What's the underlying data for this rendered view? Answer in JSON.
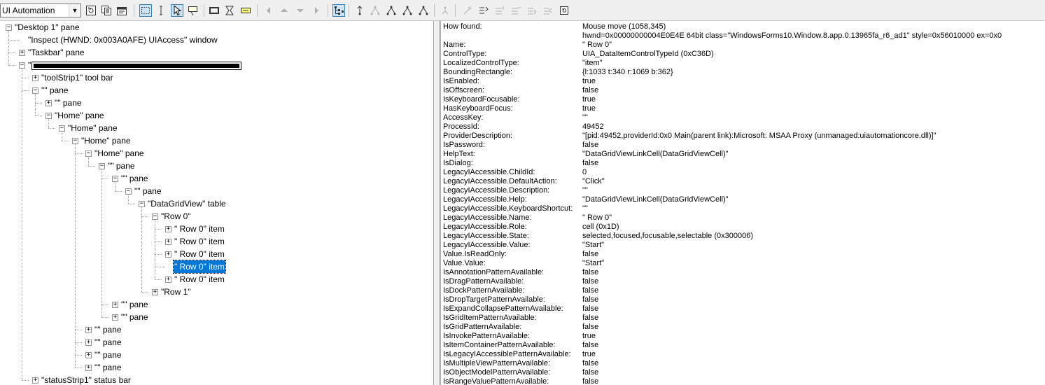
{
  "toolbar": {
    "mode_value": "UI Automation",
    "buttons": [
      "refresh-icon",
      "copy-icon",
      "options-icon",
      "watch-focus-icon",
      "watch-caret-icon",
      "watch-cursor-icon",
      "show-tooltip-icon",
      "highlight-rectangle-icon",
      "show-hidden-icon",
      "show-caret-rect-icon",
      "navigate-back-icon",
      "navigate-parent-icon",
      "navigate-first-child-icon",
      "navigate-next-icon",
      "show-tree-icon",
      "navigate-up-icon",
      "navigate-prev-sibling-icon",
      "navigate-first-icon",
      "navigate-last-icon",
      "navigate-next-sibling-icon",
      "action-icon",
      "default-action-icon",
      "select-icon",
      "add-selection-icon",
      "remove-selection-icon",
      "take-focus-icon",
      "refresh-element-icon"
    ]
  },
  "tree": [
    {
      "label": "\"Desktop 1\" pane",
      "toggle": "-"
    },
    {
      "label": "\"Inspect  (HWND: 0x003A0AFE) UIAccess\" window",
      "toggle": ""
    },
    {
      "label": "\"Taskbar\" pane",
      "toggle": "+"
    },
    {
      "label": "\"",
      "toggle": "-",
      "redacted": true
    },
    {
      "label": "\"toolStrip1\" tool bar",
      "toggle": "+"
    },
    {
      "label": "\"\" pane",
      "toggle": "-"
    },
    {
      "label": "\"\" pane",
      "toggle": "+"
    },
    {
      "label": "\"Home\" pane",
      "toggle": "-"
    },
    {
      "label": "\"Home\" pane",
      "toggle": "-"
    },
    {
      "label": "\"Home\" pane",
      "toggle": "-"
    },
    {
      "label": "\"Home\" pane",
      "toggle": "-"
    },
    {
      "label": "\"\" pane",
      "toggle": "-"
    },
    {
      "label": "\"\" pane",
      "toggle": "-"
    },
    {
      "label": "\"\" pane",
      "toggle": "-"
    },
    {
      "label": "\"DataGridView\" table",
      "toggle": "-"
    },
    {
      "label": "\"Row 0\"",
      "toggle": "-"
    },
    {
      "label": "\" Row 0\" item",
      "toggle": "+"
    },
    {
      "label": "\" Row 0\" item",
      "toggle": "+"
    },
    {
      "label": "\" Row 0\" item",
      "toggle": "+"
    },
    {
      "label": "\" Row 0\" item",
      "toggle": "",
      "selected": true
    },
    {
      "label": "\" Row 0\" item",
      "toggle": "+"
    },
    {
      "label": "\"Row 1\"",
      "toggle": "+"
    },
    {
      "label": "\"\" pane",
      "toggle": "+"
    },
    {
      "label": "\"\" pane",
      "toggle": "+"
    },
    {
      "label": "\"\" pane",
      "toggle": "+"
    },
    {
      "label": "\"\" pane",
      "toggle": "+"
    },
    {
      "label": "\"\" pane",
      "toggle": "+"
    },
    {
      "label": "\"\" pane",
      "toggle": "+"
    },
    {
      "label": "\"statusStrip1\" status bar",
      "toggle": "+"
    }
  ],
  "properties": [
    {
      "key": "How found:",
      "value": "Mouse move (1058,345)"
    },
    {
      "key": "",
      "value": "hwnd=0x00000000004E0E4E 64bit class=\"WindowsForms10.Window.8.app.0.13965fa_r6_ad1\" style=0x56010000 ex=0x0"
    },
    {
      "key": "Name:",
      "value": "\" Row 0\""
    },
    {
      "key": "ControlType:",
      "value": "UIA_DataItemControlTypeId (0xC36D)"
    },
    {
      "key": "LocalizedControlType:",
      "value": "\"item\""
    },
    {
      "key": "BoundingRectangle:",
      "value": "{l:1033 t:340 r:1069 b:362}"
    },
    {
      "key": "IsEnabled:",
      "value": "true"
    },
    {
      "key": "IsOffscreen:",
      "value": "false"
    },
    {
      "key": "IsKeyboardFocusable:",
      "value": "true"
    },
    {
      "key": "HasKeyboardFocus:",
      "value": "true"
    },
    {
      "key": "AccessKey:",
      "value": "\"\""
    },
    {
      "key": "ProcessId:",
      "value": "49452"
    },
    {
      "key": "ProviderDescription:",
      "value": "\"[pid:49452,providerId:0x0 Main(parent link):Microsoft: MSAA Proxy (unmanaged:uiautomationcore.dll)]\""
    },
    {
      "key": "IsPassword:",
      "value": "false"
    },
    {
      "key": "HelpText:",
      "value": "\"DataGridViewLinkCell(DataGridViewCell)\""
    },
    {
      "key": "IsDialog:",
      "value": "false"
    },
    {
      "key": "LegacyIAccessible.ChildId:",
      "value": "0"
    },
    {
      "key": "LegacyIAccessible.DefaultAction:",
      "value": "\"Click\""
    },
    {
      "key": "LegacyIAccessible.Description:",
      "value": "\"\""
    },
    {
      "key": "LegacyIAccessible.Help:",
      "value": "\"DataGridViewLinkCell(DataGridViewCell)\""
    },
    {
      "key": "LegacyIAccessible.KeyboardShortcut:",
      "value": "\"\""
    },
    {
      "key": "LegacyIAccessible.Name:",
      "value": "\" Row 0\""
    },
    {
      "key": "LegacyIAccessible.Role:",
      "value": "cell (0x1D)"
    },
    {
      "key": "LegacyIAccessible.State:",
      "value": "selected,focused,focusable,selectable (0x300006)"
    },
    {
      "key": "LegacyIAccessible.Value:",
      "value": "\"Start\""
    },
    {
      "key": "Value.IsReadOnly:",
      "value": "false"
    },
    {
      "key": "Value.Value:",
      "value": "\"Start\""
    },
    {
      "key": "IsAnnotationPatternAvailable:",
      "value": "false"
    },
    {
      "key": "IsDragPatternAvailable:",
      "value": "false"
    },
    {
      "key": "IsDockPatternAvailable:",
      "value": "false"
    },
    {
      "key": "IsDropTargetPatternAvailable:",
      "value": "false"
    },
    {
      "key": "IsExpandCollapsePatternAvailable:",
      "value": "false"
    },
    {
      "key": "IsGridItemPatternAvailable:",
      "value": "false"
    },
    {
      "key": "IsGridPatternAvailable:",
      "value": "false"
    },
    {
      "key": "IsInvokePatternAvailable:",
      "value": "true"
    },
    {
      "key": "IsItemContainerPatternAvailable:",
      "value": "false"
    },
    {
      "key": "IsLegacyIAccessiblePatternAvailable:",
      "value": "true"
    },
    {
      "key": "IsMultipleViewPatternAvailable:",
      "value": "false"
    },
    {
      "key": "IsObjectModelPatternAvailable:",
      "value": "false"
    },
    {
      "key": "IsRangeValuePatternAvailable:",
      "value": "false"
    }
  ]
}
